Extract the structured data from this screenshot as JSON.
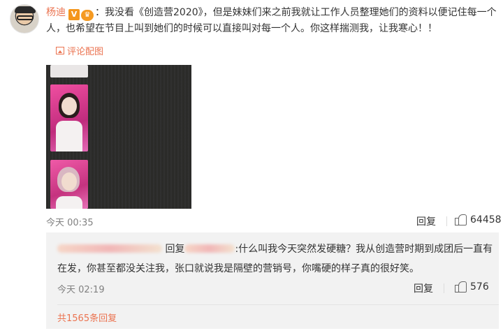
{
  "comment": {
    "username": "杨迪",
    "badge_v": "V",
    "badge_crown": "♛",
    "text": "：我没看《创造营2020》，但是妹妹们来之前我就让工作人员整理她们的资料以便记住每一个人，也希望在节目上叫到她们的时候可以直接叫对每一个人。你这样揣测我，让我寒心！！",
    "pic_link": "评论配图",
    "time": "今天 00:35",
    "reply_label": "回复",
    "likes": "64458"
  },
  "reply": {
    "reply_prefix": "回复",
    "text": ":什么叫我今天突然发硬糖？我从创造营时期到成团后一直有在发，你甚至都没关注我，张口就说我是隔壁的营销号，你嘴硬的样子真的很好笑。",
    "time": "今天 02:19",
    "reply_label": "回复",
    "likes": "576"
  },
  "total_replies": "共1565条回复",
  "colors": {
    "accent": "#eb7350",
    "badge": "#f4961d",
    "reply_bg": "#f2f2f2"
  },
  "icons": {
    "like": "thumbs-up-icon",
    "image": "image-icon"
  }
}
